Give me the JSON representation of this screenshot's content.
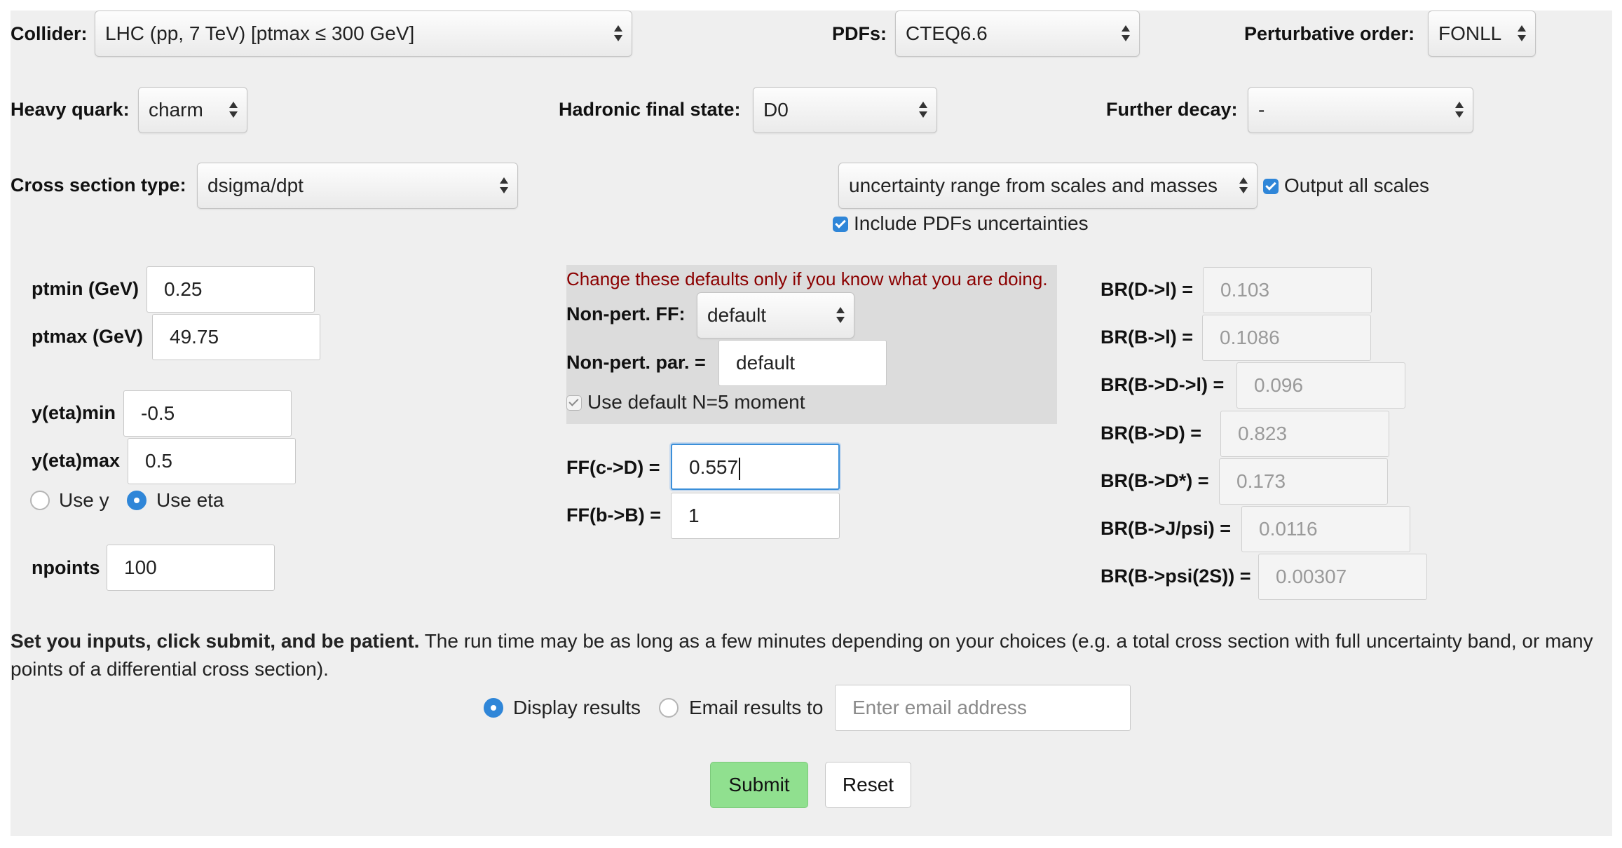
{
  "row1": {
    "collider_label": "Collider:",
    "collider_value": "LHC (pp, 7 TeV)    [ptmax ≤ 300 GeV]",
    "pdfs_label": "PDFs:",
    "pdfs_value": "CTEQ6.6",
    "order_label": "Perturbative order:",
    "order_value": "FONLL"
  },
  "row2": {
    "quark_label": "Heavy quark:",
    "quark_value": "charm",
    "hadron_label": "Hadronic final state:",
    "hadron_value": "D0",
    "decay_label": "Further decay:",
    "decay_value": "-"
  },
  "row3": {
    "xsec_label": "Cross section type:",
    "xsec_value": "dsigma/dpt",
    "uncert_value": "uncertainty range from scales and masses",
    "output_scales_label": "Output all scales",
    "output_scales_checked": true,
    "include_pdf_label": "Include PDFs uncertainties",
    "include_pdf_checked": true
  },
  "kinematics": {
    "ptmin_label": "ptmin (GeV)",
    "ptmin_value": "0.25",
    "ptmax_label": "ptmax (GeV)",
    "ptmax_value": "49.75",
    "ymin_label": "y(eta)min",
    "ymin_value": "-0.5",
    "ymax_label": "y(eta)max",
    "ymax_value": "0.5",
    "use_y_label": "Use y",
    "use_eta_label": "Use eta",
    "selected_rapidity": "Use eta",
    "npoints_label": "npoints",
    "npoints_value": "100"
  },
  "advanced": {
    "warning": "Change these defaults only if you know what you are doing.",
    "warning_color": "#8b0000",
    "ff_label": "Non-pert. FF:",
    "ff_value": "default",
    "par_label": "Non-pert. par. =",
    "par_value": "default",
    "moment_label": "Use default N=5 moment",
    "moment_checked": true,
    "ffc_label": "FF(c->D) =",
    "ffc_value": "0.557",
    "ffb_label": "FF(b->B) =",
    "ffb_value": "1"
  },
  "branching": [
    {
      "label": "BR(D->l) =",
      "value": "0.103"
    },
    {
      "label": "BR(B->l) =",
      "value": "0.1086"
    },
    {
      "label": "BR(B->D->l) =",
      "value": "0.096"
    },
    {
      "label": "BR(B->D) =",
      "value": "0.823"
    },
    {
      "label": "BR(B->D*) =",
      "value": "0.173"
    },
    {
      "label": "BR(B->J/psi) =",
      "value": "0.0116"
    },
    {
      "label": "BR(B->psi(2S)) =",
      "value": "0.00307"
    }
  ],
  "footer": {
    "note_bold": "Set you inputs, click submit, and be patient.",
    "note_rest": " The run time may be as long as a few minutes depending on your choices (e.g. a total cross section with full uncertainty band, or many points of a differential cross section).",
    "display_label": "Display results",
    "email_label": "Email results to",
    "selected_output": "Display results",
    "email_placeholder": "Enter email address",
    "submit_label": "Submit",
    "reset_label": "Reset",
    "submit_color": "#90e08f"
  },
  "colors": {
    "panel_bg": "#efefef",
    "advanced_bg": "#dcdcdc",
    "accent": "#2f86d8"
  }
}
